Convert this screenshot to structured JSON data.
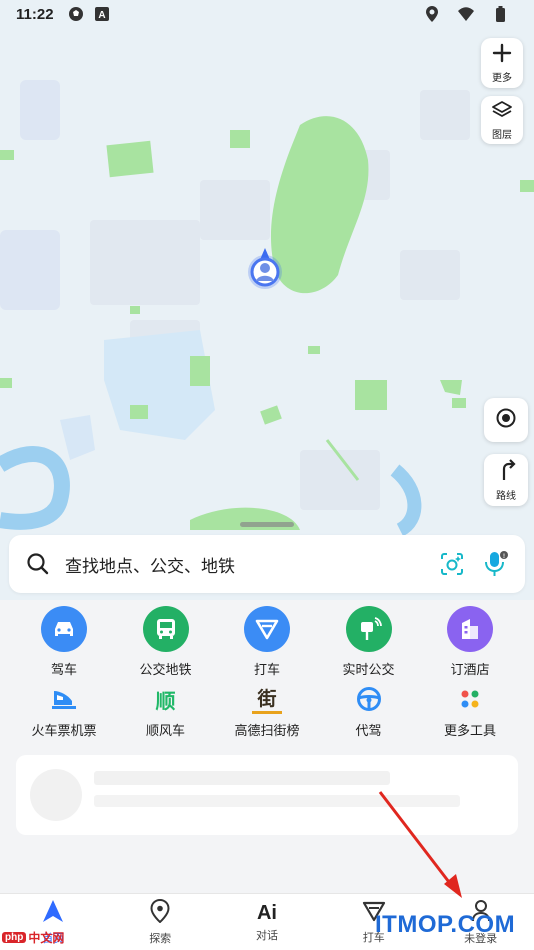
{
  "status_bar": {
    "time": "11:22",
    "left_icons": [
      "soccer-ball-icon",
      "a-badge-icon"
    ],
    "right_icons": [
      "location-pin-icon",
      "wifi-icon",
      "battery-icon"
    ]
  },
  "map_controls": {
    "more_label": "更多",
    "layers_label": "图层",
    "route_label": "路线"
  },
  "search": {
    "placeholder": "查找地点、公交、地铁"
  },
  "tools_primary": [
    {
      "label": "驾车",
      "color": "#3b8cf5",
      "icon": "car-icon"
    },
    {
      "label": "公交地铁",
      "color": "#23b065",
      "icon": "bus-icon"
    },
    {
      "label": "打车",
      "color": "#3b8cf5",
      "icon": "taxi-icon"
    },
    {
      "label": "实时公交",
      "color": "#23b065",
      "icon": "bus-stop-icon"
    },
    {
      "label": "订酒店",
      "color": "#8a63f0",
      "icon": "hotel-icon"
    }
  ],
  "tools_secondary": [
    {
      "label": "火车票机票",
      "icon": "train-icon"
    },
    {
      "label": "顺风车",
      "icon": "shunfeng-icon",
      "glyph": "顺"
    },
    {
      "label": "高德扫街榜",
      "icon": "street-list-icon",
      "glyph": "街"
    },
    {
      "label": "代驾",
      "icon": "steering-wheel-icon"
    },
    {
      "label": "更多工具",
      "icon": "grid-icon"
    }
  ],
  "bottom_nav": [
    {
      "label": "首页",
      "icon": "home-arrow-icon",
      "active": true
    },
    {
      "label": "探索",
      "icon": "explore-pin-icon",
      "active": false
    },
    {
      "label": "对话",
      "icon": "ai-icon",
      "glyph": "Ai",
      "active": false
    },
    {
      "label": "打车",
      "icon": "taxi-icon",
      "active": false
    },
    {
      "label": "未登录",
      "icon": "user-icon",
      "active": false
    }
  ],
  "watermarks": {
    "left_php": "php",
    "left_text": "中文网",
    "right_text": "ITMOP.COM"
  },
  "colors": {
    "map_bg": "#e9f1f6",
    "park_green": "#a8e3a0",
    "river_blue": "#9ccff0",
    "accent_blue": "#2f6bff",
    "annotation_red": "#e0271f"
  }
}
